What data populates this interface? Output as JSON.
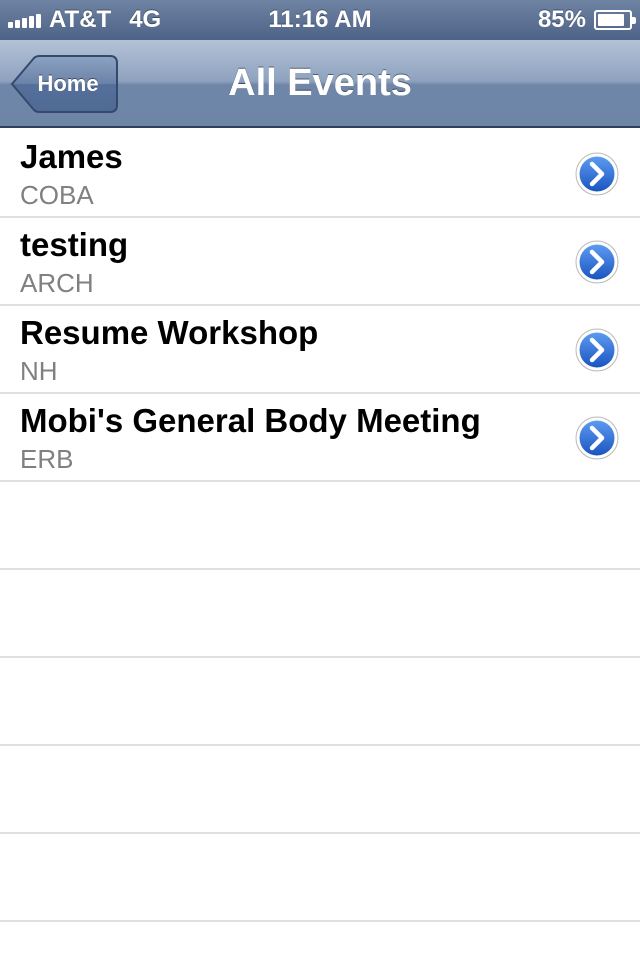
{
  "status": {
    "carrier": "AT&T",
    "network": "4G",
    "time": "11:16 AM",
    "battery_percent_text": "85%",
    "battery_level": 0.85,
    "signal_bars": 5
  },
  "nav": {
    "back_label": "Home",
    "title": "All Events"
  },
  "events": [
    {
      "title": "James",
      "subtitle": "COBA"
    },
    {
      "title": "testing",
      "subtitle": "ARCH"
    },
    {
      "title": "Resume Workshop",
      "subtitle": "NH"
    },
    {
      "title": "Mobi's General Body Meeting",
      "subtitle": "ERB"
    }
  ],
  "icons": {
    "disclosure": "chevron-right-circle-icon",
    "back": "back-arrow-icon",
    "signal": "signal-icon",
    "battery": "battery-icon"
  },
  "colors": {
    "nav_bar": "#8ea2bf",
    "disclosure_blue": "#2f6fd6",
    "subtitle_gray": "#808080"
  }
}
